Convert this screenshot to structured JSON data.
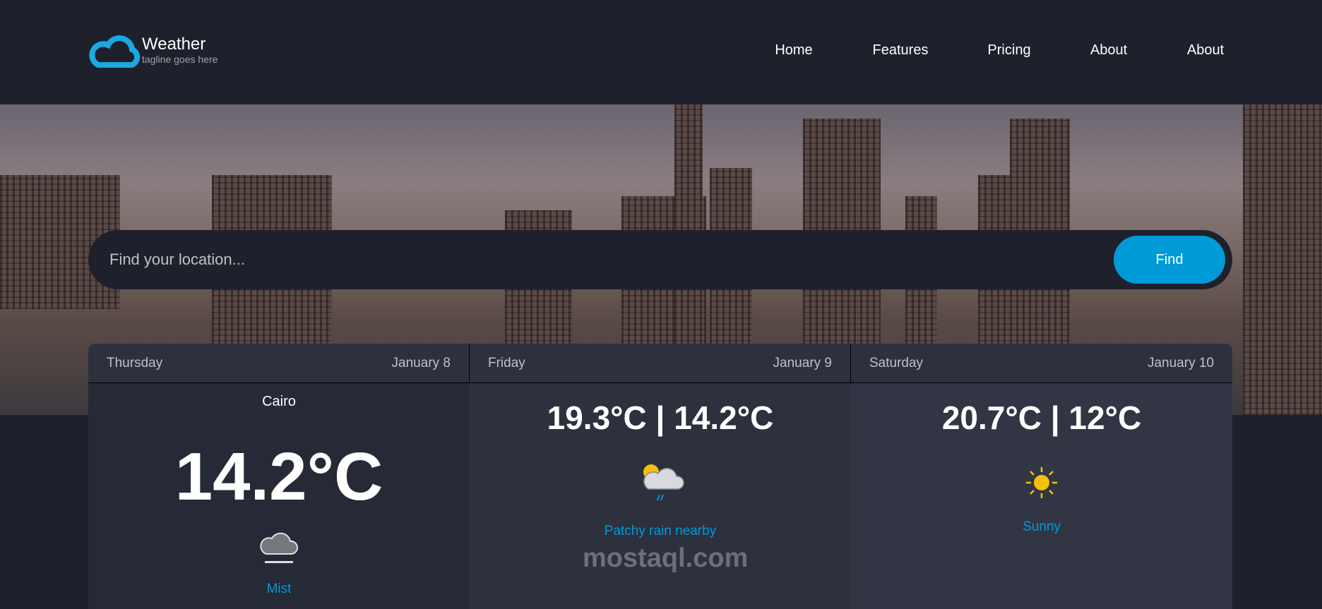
{
  "header": {
    "brand": "Weather",
    "tagline": "tagline goes here",
    "nav": [
      "Home",
      "Features",
      "Pricing",
      "About",
      "About"
    ]
  },
  "search": {
    "placeholder": "Find your location...",
    "button": "Find"
  },
  "forecast": [
    {
      "day": "Thursday",
      "date": "January 8",
      "city": "Cairo",
      "temp": "14.2°C",
      "icon": "mist-icon",
      "condition": "Mist"
    },
    {
      "day": "Friday",
      "date": "January 9",
      "range": "19.3°C | 14.2°C",
      "icon": "patchy-rain-icon",
      "condition": "Patchy rain nearby"
    },
    {
      "day": "Saturday",
      "date": "January 10",
      "range": "20.7°C | 12°C",
      "icon": "sun-icon",
      "condition": "Sunny"
    }
  ],
  "watermark": "mostaql.com",
  "colors": {
    "accent": "#009ad8",
    "background": "#1e202b"
  }
}
